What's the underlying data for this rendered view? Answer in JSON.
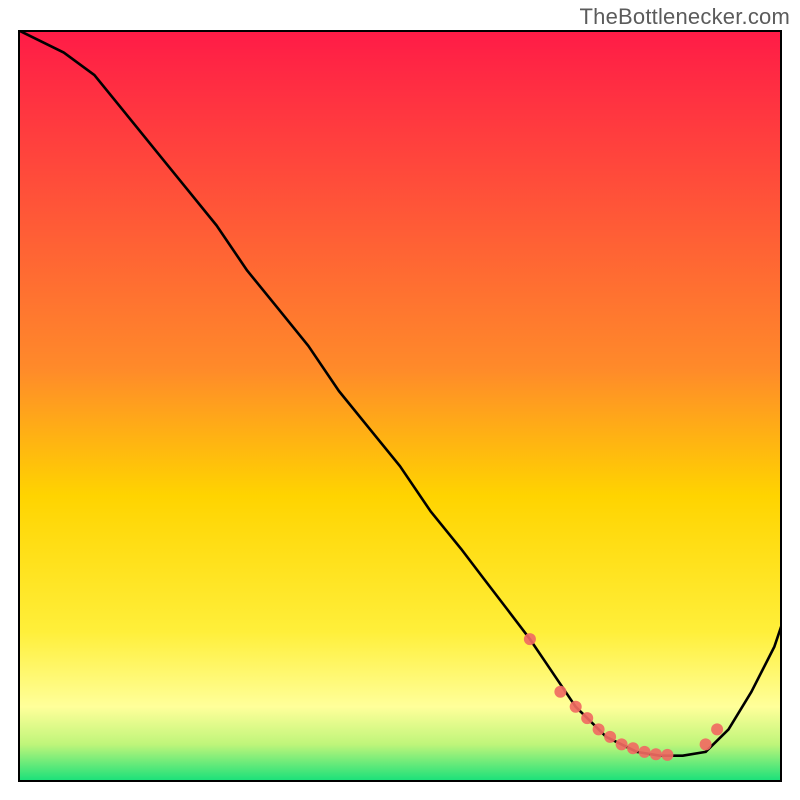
{
  "watermark": "TheBottlenecker.com",
  "colors": {
    "top": "#ff1b47",
    "mid": "#ffd400",
    "pale": "#ffff9a",
    "bottom": "#14e07a",
    "line": "#000000",
    "marker": "#f06a62",
    "frame": "#000000"
  },
  "chart_data": {
    "type": "line",
    "title": "",
    "xlabel": "",
    "ylabel": "",
    "xlim": [
      0,
      100
    ],
    "ylim": [
      0,
      100
    ],
    "series": [
      {
        "name": "bottleneck-curve",
        "x": [
          0,
          6,
          10,
          14,
          18,
          22,
          26,
          30,
          34,
          38,
          42,
          46,
          50,
          54,
          58,
          61,
          64,
          67,
          69,
          71,
          73,
          75,
          77,
          79,
          81,
          84,
          87,
          90,
          93,
          96,
          99,
          100
        ],
        "y": [
          100,
          97,
          94,
          89,
          84,
          79,
          74,
          68,
          63,
          58,
          52,
          47,
          42,
          36,
          31,
          27,
          23,
          19,
          16,
          13,
          10,
          8,
          6,
          5,
          4,
          3.5,
          3.5,
          4,
          7,
          12,
          18,
          21
        ]
      }
    ],
    "markers": {
      "name": "highlight-dots",
      "points": [
        {
          "x": 67,
          "y": 19
        },
        {
          "x": 71,
          "y": 12
        },
        {
          "x": 73,
          "y": 10
        },
        {
          "x": 74.5,
          "y": 8.5
        },
        {
          "x": 76,
          "y": 7
        },
        {
          "x": 77.5,
          "y": 6
        },
        {
          "x": 79,
          "y": 5
        },
        {
          "x": 80.5,
          "y": 4.5
        },
        {
          "x": 82,
          "y": 4
        },
        {
          "x": 83.5,
          "y": 3.7
        },
        {
          "x": 85,
          "y": 3.6
        },
        {
          "x": 90,
          "y": 5
        },
        {
          "x": 91.5,
          "y": 7
        }
      ]
    }
  }
}
